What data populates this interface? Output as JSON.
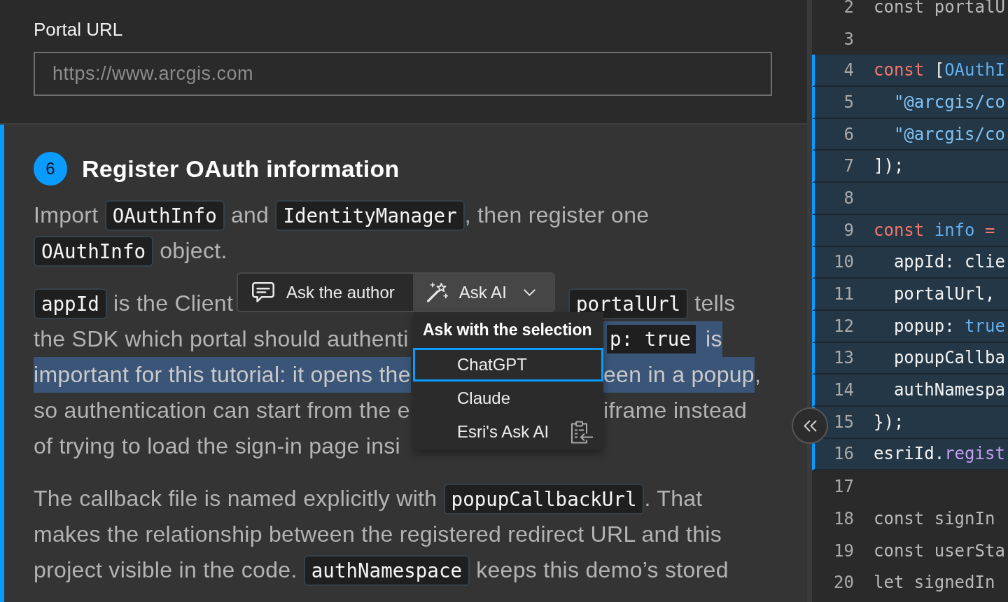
{
  "portal_url": {
    "label": "Portal URL",
    "placeholder": "https://www.arcgis.com"
  },
  "step": {
    "number": "6",
    "title": "Register OAuth information",
    "paragraphs": [
      {
        "lines": [
          {
            "runs": [
              {
                "segments": [
                  {
                    "kind": "text",
                    "text": "Import "
                  },
                  {
                    "kind": "code",
                    "text": "OAuthInfo"
                  },
                  {
                    "kind": "text",
                    "text": " and "
                  },
                  {
                    "kind": "code",
                    "text": "IdentityManager"
                  },
                  {
                    "kind": "text",
                    "text": ", then register one"
                  }
                ]
              }
            ]
          },
          {
            "runs": [
              {
                "segments": [
                  {
                    "kind": "code",
                    "text": "OAuthInfo"
                  },
                  {
                    "kind": "text",
                    "text": " object."
                  }
                ]
              }
            ]
          }
        ]
      },
      {
        "lines": [
          {
            "runs": [
              {
                "segments": [
                  {
                    "kind": "code",
                    "text": "appId",
                    "selected": false
                  },
                  {
                    "kind": "text",
                    "text": " is the Client",
                    "selected": false
                  }
                ]
              },
              {
                "segments": [
                  {
                    "kind": "code",
                    "text": "portalUrl",
                    "selected": false
                  },
                  {
                    "kind": "text",
                    "text": " tells",
                    "selected": false
                  }
                ]
              }
            ]
          },
          {
            "runs": [
              {
                "segments": [
                  {
                    "kind": "text",
                    "text": "the SDK which portal should authenti",
                    "selected": false
                  }
                ]
              },
              {
                "segments": [
                  {
                    "kind": "code",
                    "text": "p: true",
                    "selected": true
                  },
                  {
                    "kind": "text",
                    "text": " is",
                    "selected": true
                  }
                ]
              }
            ]
          },
          {
            "runs": [
              {
                "segments": [
                  {
                    "kind": "text",
                    "text": "important for this tutorial: it opens the",
                    "selected": true
                  }
                ]
              },
              {
                "segments": [
                  {
                    "kind": "text",
                    "text": "een in a popup",
                    "selected": true
                  },
                  {
                    "kind": "text",
                    "text": ",",
                    "selected": false
                  }
                ]
              }
            ]
          },
          {
            "runs": [
              {
                "segments": [
                  {
                    "kind": "text",
                    "text": "so authentication can start from the e",
                    "selected": false
                  }
                ]
              },
              {
                "segments": [
                  {
                    "kind": "text",
                    "text": "iframe instead",
                    "selected": false
                  }
                ]
              }
            ]
          },
          {
            "runs": [
              {
                "segments": [
                  {
                    "kind": "text",
                    "text": "of trying to load the sign-in page insi",
                    "selected": false
                  }
                ]
              }
            ]
          }
        ]
      },
      {
        "lines": [
          {
            "runs": [
              {
                "segments": [
                  {
                    "kind": "text",
                    "text": "The callback file is named explicitly with "
                  },
                  {
                    "kind": "code",
                    "text": "popupCallbackUrl"
                  },
                  {
                    "kind": "text",
                    "text": ". That"
                  }
                ]
              }
            ]
          },
          {
            "runs": [
              {
                "segments": [
                  {
                    "kind": "text",
                    "text": "makes the relationship between the registered redirect URL and this"
                  }
                ]
              }
            ]
          },
          {
            "runs": [
              {
                "segments": [
                  {
                    "kind": "text",
                    "text": "project visible in the code. "
                  },
                  {
                    "kind": "code",
                    "text": "authNamespace"
                  },
                  {
                    "kind": "text",
                    "text": " keeps this demo’s stored"
                  }
                ]
              }
            ]
          }
        ]
      }
    ]
  },
  "selection_toolbar": {
    "author_button": {
      "label": "Ask the author"
    },
    "ai_button": {
      "label": "Ask AI",
      "expanded": true
    },
    "menu": {
      "heading": "Ask with the selection",
      "items": [
        {
          "label": "ChatGPT",
          "selected": true,
          "kind": "plain"
        },
        {
          "label": "Claude",
          "selected": false,
          "kind": "plain"
        },
        {
          "label": "Esri's Ask AI",
          "selected": false,
          "kind": "clipboard"
        }
      ]
    }
  },
  "code_panel": {
    "lines": [
      {
        "number": "2",
        "highlighted": false,
        "tokens": [
          {
            "kind": "plain",
            "text": "const portalU"
          }
        ]
      },
      {
        "number": "3",
        "highlighted": false
      },
      {
        "number": "4",
        "highlighted": true,
        "tokens": [
          {
            "kind": "keyword",
            "text": "const"
          },
          {
            "kind": "plain",
            "text": " ["
          },
          {
            "kind": "name",
            "text": "OAuthI"
          }
        ]
      },
      {
        "number": "5",
        "highlighted": true,
        "tokens": [
          {
            "kind": "string",
            "text": "  \"@arcgis/co"
          }
        ]
      },
      {
        "number": "6",
        "highlighted": true,
        "tokens": [
          {
            "kind": "string",
            "text": "  \"@arcgis/co"
          }
        ]
      },
      {
        "number": "7",
        "highlighted": true,
        "tokens": [
          {
            "kind": "plain",
            "text": "]);"
          }
        ]
      },
      {
        "number": "8",
        "highlighted": true
      },
      {
        "number": "9",
        "highlighted": true,
        "tokens": [
          {
            "kind": "keyword",
            "text": "const"
          },
          {
            "kind": "name",
            "text": " info"
          },
          {
            "kind": "keyword",
            "text": " ="
          }
        ]
      },
      {
        "number": "10",
        "highlighted": true,
        "tokens": [
          {
            "kind": "plain",
            "text": "  appId: clie"
          }
        ]
      },
      {
        "number": "11",
        "highlighted": true,
        "tokens": [
          {
            "kind": "plain",
            "text": "  portalUrl,"
          }
        ]
      },
      {
        "number": "12",
        "highlighted": true,
        "tokens": [
          {
            "kind": "plain",
            "text": "  popup: "
          },
          {
            "kind": "name",
            "text": "true"
          }
        ]
      },
      {
        "number": "13",
        "highlighted": true,
        "tokens": [
          {
            "kind": "plain",
            "text": "  popupCallba"
          }
        ]
      },
      {
        "number": "14",
        "highlighted": true,
        "tokens": [
          {
            "kind": "plain",
            "text": "  authNamespa"
          }
        ]
      },
      {
        "number": "15",
        "highlighted": true,
        "tokens": [
          {
            "kind": "plain",
            "text": "});"
          }
        ]
      },
      {
        "number": "16",
        "highlighted": true,
        "tokens": [
          {
            "kind": "plain",
            "text": "esriId."
          },
          {
            "kind": "method",
            "text": "regist"
          }
        ]
      },
      {
        "number": "17",
        "highlighted": false
      },
      {
        "number": "18",
        "highlighted": false,
        "tokens": [
          {
            "kind": "plain",
            "text": "const signIn"
          }
        ]
      },
      {
        "number": "19",
        "highlighted": false,
        "tokens": [
          {
            "kind": "plain",
            "text": "const userSta"
          }
        ]
      },
      {
        "number": "20",
        "highlighted": false,
        "tokens": [
          {
            "kind": "plain",
            "text": "let signedIn"
          }
        ]
      }
    ]
  }
}
